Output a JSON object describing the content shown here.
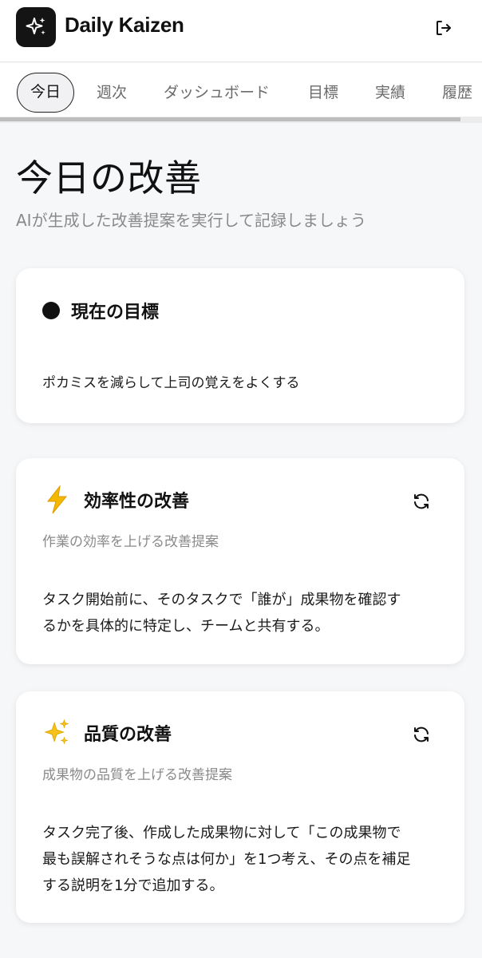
{
  "app": {
    "title": "Daily Kaizen",
    "logo_icon": "sparkles-icon",
    "logout_icon": "logout-icon"
  },
  "tabs": [
    {
      "label": "今日",
      "active": true
    },
    {
      "label": "週次",
      "active": false
    },
    {
      "label": "ダッシュボード",
      "active": false
    },
    {
      "label": "目標",
      "active": false
    },
    {
      "label": "実績",
      "active": false
    },
    {
      "label": "履歴",
      "active": false
    }
  ],
  "page": {
    "title": "今日の改善",
    "subtitle": "AIが生成した改善提案を実行して記録しましょう"
  },
  "goal_card": {
    "title": "現在の目標",
    "body": "ポカミスを減らして上司の覚えをよくする"
  },
  "efficiency_card": {
    "icon": "lightning-icon",
    "title": "効率性の改善",
    "subtitle": "作業の効率を上げる改善提案",
    "body_lines": [
      "タスク開始前に、そのタスクで「誰が」成果物を確認す",
      "るかを具体的に特定し、チームと共有する。"
    ]
  },
  "quality_card": {
    "icon": "sparkles-icon",
    "title": "品質の改善",
    "subtitle": "成果物の品質を上げる改善提案",
    "body_lines": [
      "タスク完了後、作成した成果物に対して「この成果物で",
      "最も誤解されそうな点は何か」を1つ考え、その点を補足",
      "する説明を1分で追加する。"
    ]
  },
  "colors": {
    "background": "#f6f7f9",
    "card": "#ffffff",
    "text": "#111111",
    "muted": "#8a8a8a",
    "lightning": "#f5b800",
    "sparkle": "#f7c21b"
  }
}
